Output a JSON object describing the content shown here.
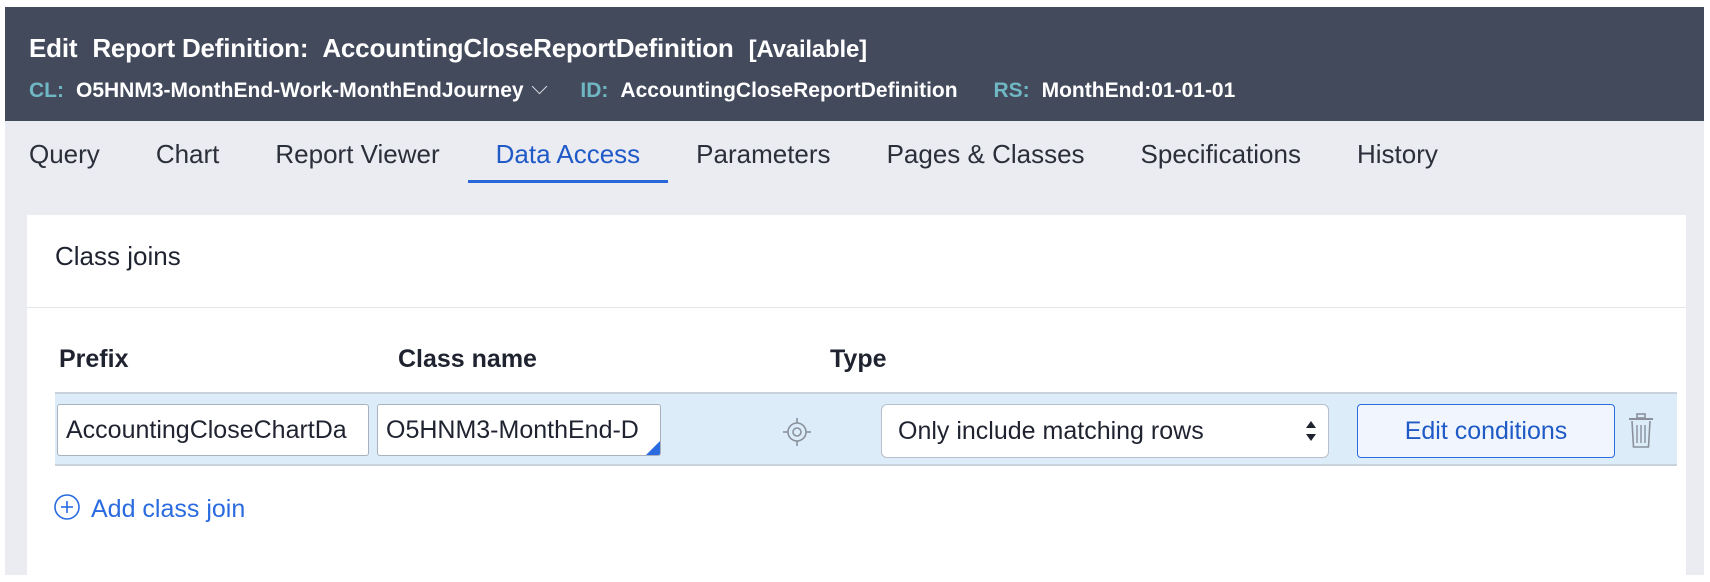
{
  "header": {
    "title_prefix": "Edit",
    "rule_type": "Report Definition:",
    "rule_name": "AccountingCloseReportDefinition",
    "status": "[Available]",
    "cl_label": "CL:",
    "cl_value": "O5HNM3-MonthEnd-Work-MonthEndJourney",
    "id_label": "ID:",
    "id_value": "AccountingCloseReportDefinition",
    "rs_label": "RS:",
    "rs_value": "MonthEnd:01-01-01"
  },
  "tabs": [
    {
      "label": "Query"
    },
    {
      "label": "Chart"
    },
    {
      "label": "Report Viewer"
    },
    {
      "label": "Data Access",
      "active": true
    },
    {
      "label": "Parameters"
    },
    {
      "label": "Pages & Classes"
    },
    {
      "label": "Specifications"
    },
    {
      "label": "History"
    }
  ],
  "panel": {
    "title": "Class joins",
    "columns": {
      "prefix": "Prefix",
      "class_name": "Class name",
      "type": "Type"
    },
    "row": {
      "prefix_value": "AccountingCloseChartDa",
      "class_name_value": "O5HNM3-MonthEnd-D",
      "type_value": "Only include matching rows",
      "edit_label": "Edit conditions"
    },
    "add_label": "Add class join"
  },
  "icons": {
    "target": "crosshair-target-icon",
    "trash": "trash-icon",
    "add": "plus-circle-icon",
    "chevron": "chevron-down-icon"
  },
  "colors": {
    "header_bg": "#434a5c",
    "meta_label": "#6fb7c3",
    "accent": "#2a6be0",
    "row_bg": "#dcecf8"
  }
}
